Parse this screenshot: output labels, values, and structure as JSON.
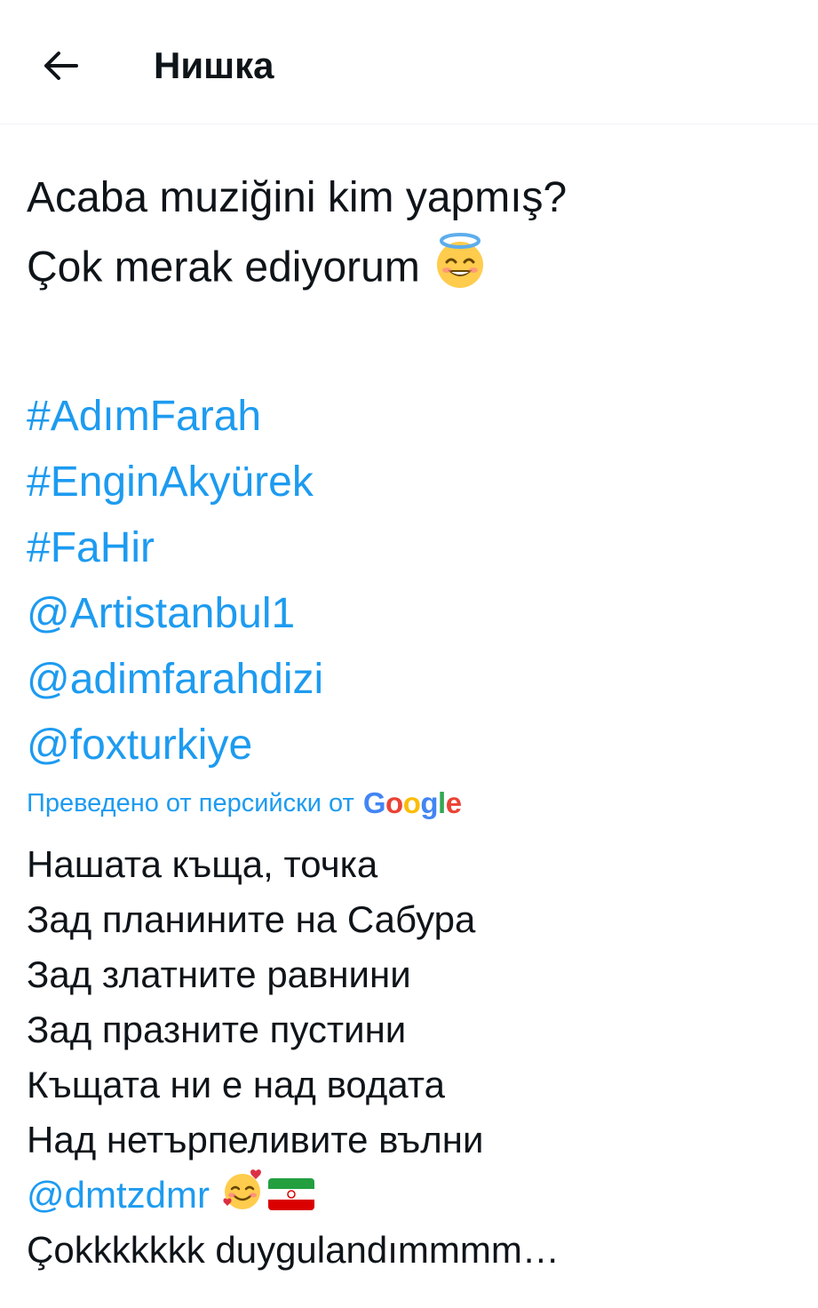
{
  "header": {
    "back_icon": "arrow-left-icon",
    "title": "Нишка"
  },
  "tweet": {
    "line1": "Acaba muziğini kim yapmış?",
    "line2": "Çok merak ediyorum",
    "line2_emoji": "smiling-face-with-halo",
    "links": [
      "#AdımFarah",
      "#EnginAkyürek",
      "#FaHir",
      "@Artistanbul1",
      "@adimfarahdizi",
      "@foxturkiye"
    ]
  },
  "translation_note": {
    "label": "Преведено от персийски от",
    "provider_letters": [
      "G",
      "o",
      "o",
      "g",
      "l",
      "e"
    ]
  },
  "translation": {
    "lines": [
      "Нашата къща, точка",
      "Зад планините на Сабура",
      "Зад златните равнини",
      "Зад празните пустини",
      "Къщата ни е над водата",
      "Над нетърпеливите вълни"
    ],
    "mention": "@dmtzdmr",
    "mention_emojis": [
      "smiling-face-with-hearts",
      "flag-iran"
    ],
    "last_line": "Çokkkkkkk duygulandımmmm…"
  },
  "colors": {
    "link": "#1d9bf0",
    "text": "#0f1419",
    "divider": "#eff3f4"
  }
}
